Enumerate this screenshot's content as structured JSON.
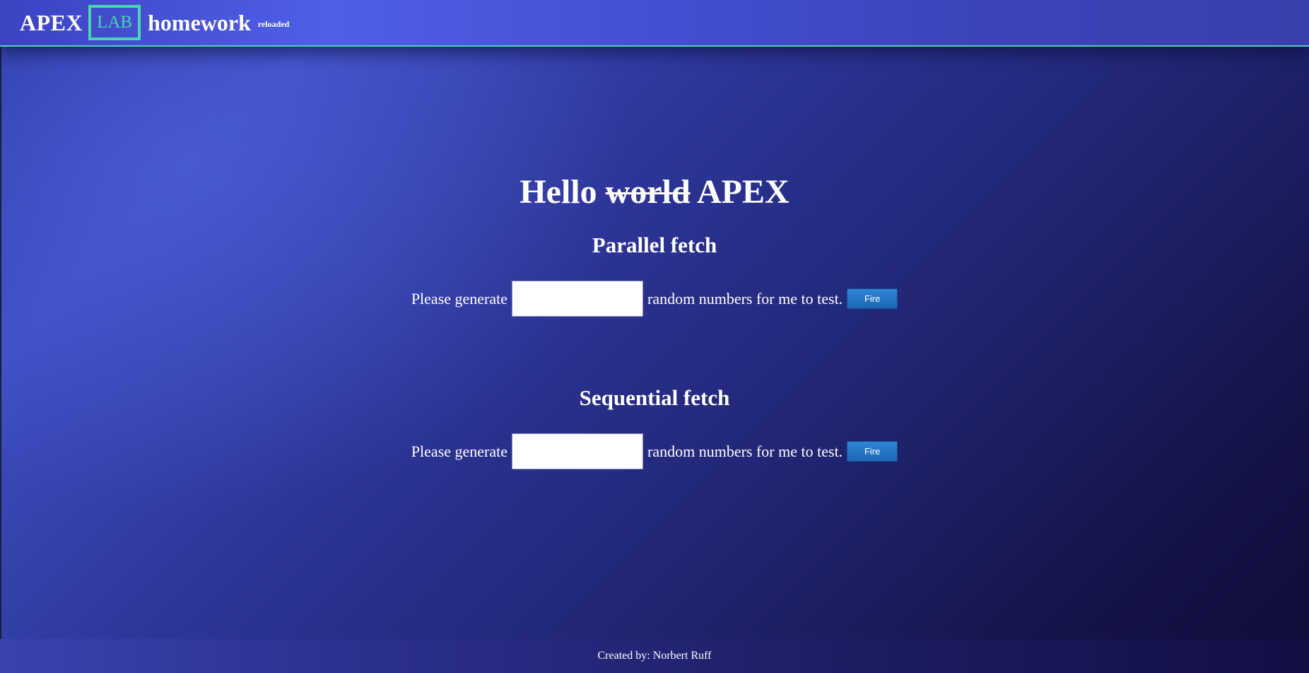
{
  "header": {
    "brand_apex": "APEX",
    "brand_lab": "LAB",
    "brand_homework": "homework",
    "brand_tag": "reloaded"
  },
  "heading": {
    "hello": "Hello",
    "struck": "world",
    "name": "APEX"
  },
  "sections": [
    {
      "title": "Parallel fetch",
      "prefix": "Please generate",
      "input_value": "",
      "suffix": "random numbers for me to test.",
      "button_label": "Fire"
    },
    {
      "title": "Sequential fetch",
      "prefix": "Please generate",
      "input_value": "",
      "suffix": "random numbers for me to test.",
      "button_label": "Fire"
    }
  ],
  "footer": {
    "credit": "Created by: Norbert Ruff"
  },
  "colors": {
    "accent": "#47d6ad",
    "button": "#1d66b6",
    "background_dark": "#0f0c38",
    "background_light": "#4f5fe8"
  }
}
